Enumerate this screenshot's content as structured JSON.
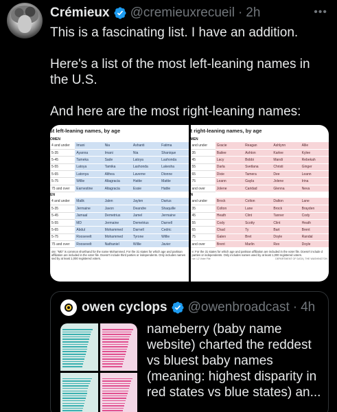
{
  "tweet": {
    "author_name": "Crémieux",
    "handle": "@cremieuxrecueil",
    "time": "2h",
    "more_label": "•••",
    "paragraphs": [
      "This is a fascinating list. I have an addition.",
      "Here's a list of the most left-leaning names in the U.S.",
      "And here are the most right-leaning names:"
    ]
  },
  "left_table": {
    "title": "ost left-leaning names, by age",
    "women_label": "OMEN",
    "men_label": "EN",
    "women_rows": [
      {
        "age": "4 and under",
        "names": [
          "Imani",
          "Nia",
          "Ashanti",
          "Fatima"
        ]
      },
      {
        "age": "5-35",
        "names": [
          "Ayanna",
          "Imani",
          "Nia",
          "Shanique"
        ]
      },
      {
        "age": "5-45",
        "names": [
          "Tameka",
          "Sade",
          "Latoya",
          "Lashonda"
        ]
      },
      {
        "age": "5-55",
        "names": [
          "Latoya",
          "Tamika",
          "Lashonda",
          "Lakesha"
        ]
      },
      {
        "age": "5-65",
        "names": [
          "Latonya",
          "Althea",
          "Laverne",
          "Dionne"
        ]
      },
      {
        "age": "5-75",
        "names": [
          "Willie",
          "Altagracia",
          "Hattie",
          "Mattie"
        ]
      },
      {
        "age": "75 and over",
        "names": [
          "Earnestine",
          "Altagracia",
          "Essie",
          "Hattie"
        ]
      }
    ],
    "men_rows": [
      {
        "age": "4 and under",
        "names": [
          "Malik",
          "Jalen",
          "Jaylen",
          "Darius"
        ]
      },
      {
        "age": "5-35",
        "names": [
          "Jermaine",
          "Javon",
          "Deandre",
          "Shaquille"
        ]
      },
      {
        "age": "5-45",
        "names": [
          "Jamaal",
          "Demetrius",
          "Jamel",
          "Jermaine"
        ]
      },
      {
        "age": "5-55",
        "names": [
          "MD",
          "Jermaine",
          "Demetrius",
          "Darnell"
        ]
      },
      {
        "age": "5-65",
        "names": [
          "Abdul",
          "Mohammed",
          "Darnell",
          "Cedric"
        ]
      },
      {
        "age": "5-75",
        "names": [
          "Roosevelt",
          "Mohammed",
          "Tyrone",
          "Willie"
        ]
      },
      {
        "age": "75 and over",
        "names": [
          "Roosevelt",
          "Nathaniel",
          "Willie",
          "Javier"
        ]
      }
    ],
    "note": "ote: \"MD\" is common shorthand for the name Mohammed. For the 31 states for which age and partisan affiliation are included in the voter file. Doesn't include third parties or independents. Only includes names sed by at least 1,000 registered voters."
  },
  "right_table": {
    "title": "st right-leaning names, by age",
    "women_label": "MEN",
    "men_label": "N",
    "women_rows": [
      {
        "age": "and under",
        "names": [
          "Gracie",
          "Reagan",
          "Ashlynn",
          "Allie"
        ]
      },
      {
        "age": "35",
        "names": [
          "Bailee",
          "Ashton",
          "Karlee",
          "Kylee"
        ]
      },
      {
        "age": "45",
        "names": [
          "Lacy",
          "Bobbi",
          "Mandi",
          "Rebekah"
        ]
      },
      {
        "age": "55",
        "names": [
          "Darla",
          "Svetlana",
          "Christi",
          "Ginger"
        ]
      },
      {
        "age": "65",
        "names": [
          "Dixie",
          "Tamera",
          "Dee",
          "Leann"
        ]
      },
      {
        "age": "75",
        "names": [
          "Leann",
          "Gayla",
          "Jolene",
          "Irina"
        ]
      },
      {
        "age": "and over",
        "names": [
          "Jolene",
          "Caridad",
          "Glenna",
          "Neva"
        ]
      }
    ],
    "men_rows": [
      {
        "age": "and under",
        "names": [
          "Brock",
          "Colton",
          "Dalton",
          "Lane"
        ]
      },
      {
        "age": "35",
        "names": [
          "Colton",
          "Lane",
          "Brock",
          "Brayden"
        ]
      },
      {
        "age": "45",
        "names": [
          "Heath",
          "Clint",
          "Tanner",
          "Cody"
        ]
      },
      {
        "age": "55",
        "names": [
          "Cody",
          "Scotty",
          "Clint",
          "Heath"
        ]
      },
      {
        "age": "65",
        "names": [
          "Chad",
          "Ty",
          "Bart",
          "Brent"
        ]
      },
      {
        "age": "75",
        "names": [
          "Galen",
          "Bret",
          "Doyle",
          "Randal"
        ]
      },
      {
        "age": "and over",
        "names": [
          "Brent",
          "Marlin",
          "Rex",
          "Doyle"
        ]
      }
    ],
    "note": "e: For the 31 states for which age and partisan affiliation are included in the voter file. Doesn't include d parties or independents. Only includes names used by at least 1,000 registered voters.",
    "source_left": "rce: L2 Voter File",
    "source_right": "DEPARTMENT OF DATA | THE WASHINGTON"
  },
  "quote": {
    "author_name": "owen cyclops",
    "handle": "@owenbroadcast",
    "time": "4h",
    "text": "nameberry (baby name website) charted the reddest vs bluest baby names (meaning: highest disparity in red states vs blue states) an...",
    "thumb_bars": {
      "top_left": [
        0.92,
        0.88,
        0.86,
        0.84,
        0.82,
        0.8,
        0.78,
        0.76,
        0.74,
        0.72,
        0.7,
        0.68,
        0.66,
        0.64,
        0.62,
        0.6
      ],
      "top_right": [
        0.95,
        0.9,
        0.88,
        0.85,
        0.83,
        0.81,
        0.8,
        0.78,
        0.76,
        0.74,
        0.72,
        0.7,
        0.68,
        0.66,
        0.64,
        0.62
      ],
      "bottom_left": [
        0.9,
        0.86,
        0.83,
        0.8,
        0.78,
        0.76,
        0.74,
        0.72,
        0.7,
        0.68,
        0.66,
        0.64,
        0.62,
        0.6
      ],
      "bottom_right": [
        0.93,
        0.89,
        0.86,
        0.84,
        0.82,
        0.8,
        0.78,
        0.76,
        0.74,
        0.72,
        0.7,
        0.68,
        0.66,
        0.64
      ]
    }
  },
  "colors": {
    "background": "#000000",
    "text": "#e7e9ea",
    "muted": "#71767b",
    "verified": "#1d9bf0",
    "left_cell": "#cfe0f3",
    "right_cell": "#f7d5d8"
  },
  "icons": {
    "verified": "verified-badge-icon",
    "more": "more-horizontal-icon"
  }
}
